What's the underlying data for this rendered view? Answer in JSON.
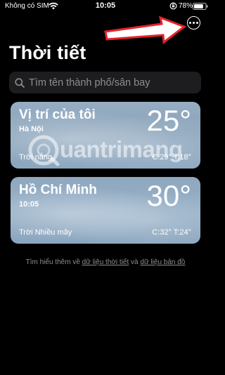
{
  "status_bar": {
    "carrier": "Không có SIM",
    "time": "10:05",
    "battery": "78%"
  },
  "page_title": "Thời tiết",
  "search": {
    "placeholder": "Tìm tên thành phố/sân bay"
  },
  "cards": [
    {
      "title": "Vị trí của tôi",
      "subtitle": "Hà Nội",
      "temp": "25°",
      "condition": "Trời nắng",
      "high_low": "C:29° T:18°"
    },
    {
      "title": "Hồ Chí Minh",
      "subtitle": "10:05",
      "temp": "30°",
      "condition": "Trời Nhiều mây",
      "high_low": "C:32° T:24°"
    }
  ],
  "footer": {
    "prefix": "Tìm hiểu thêm về ",
    "link1": "dữ liệu thời tiết",
    "middle": " và ",
    "link2": "dữ liệu bản đồ"
  },
  "watermark": "uantrimang",
  "colors": {
    "arrow": "#e5222b",
    "background": "#000000",
    "card": "#8ea8c0"
  },
  "icons": [
    "wifi-icon",
    "lock-rotation-icon",
    "battery-icon",
    "more-icon",
    "search-icon",
    "arrow-icon"
  ]
}
